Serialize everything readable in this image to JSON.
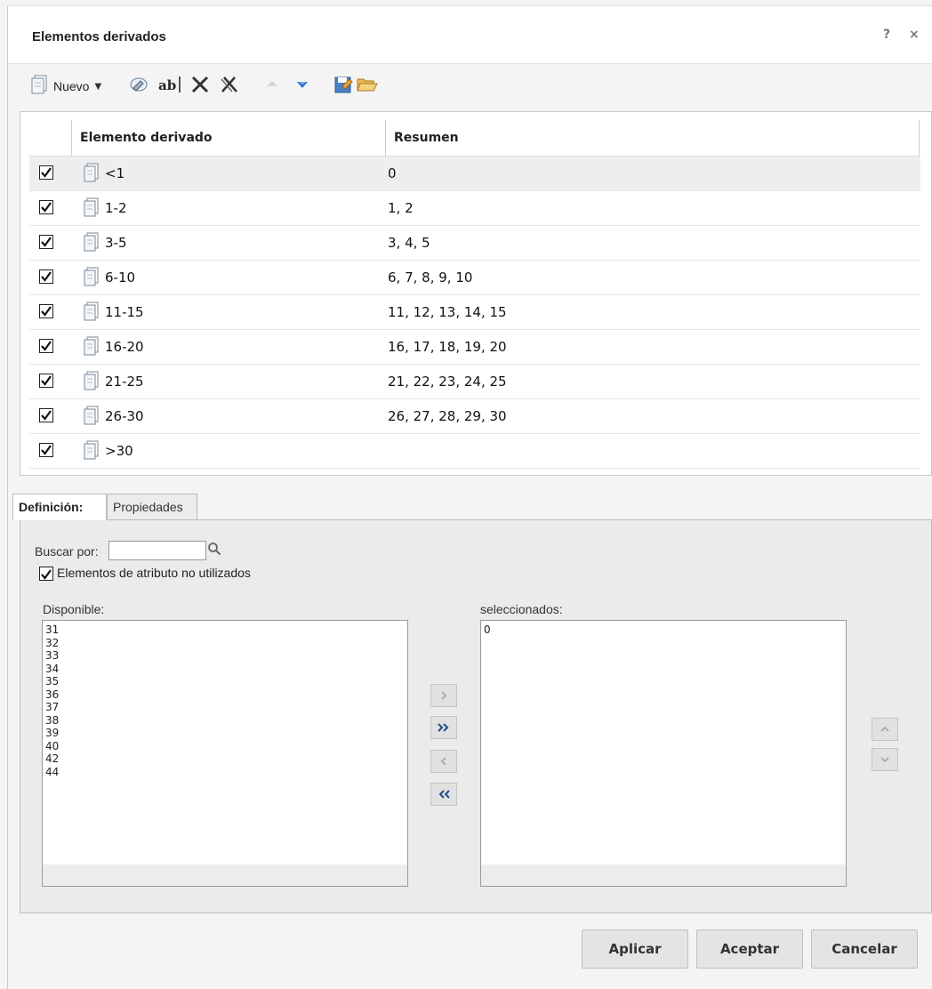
{
  "dialog": {
    "title": "Elementos derivados",
    "help_label": "?",
    "close_label": "×"
  },
  "toolbar": {
    "new_label": "Nuevo"
  },
  "grid": {
    "columns": [
      "Elemento derivado",
      "Resumen"
    ],
    "rows": [
      {
        "name": "<1",
        "summary": "0",
        "checked": true
      },
      {
        "name": "1-2",
        "summary": "1, 2",
        "checked": true
      },
      {
        "name": "3-5",
        "summary": "3, 4, 5",
        "checked": true
      },
      {
        "name": "6-10",
        "summary": "6, 7, 8, 9, 10",
        "checked": true
      },
      {
        "name": "11-15",
        "summary": "11, 12, 13, 14, 15",
        "checked": true
      },
      {
        "name": "16-20",
        "summary": "16, 17, 18, 19, 20",
        "checked": true
      },
      {
        "name": "21-25",
        "summary": "21, 22, 23, 24, 25",
        "checked": true
      },
      {
        "name": "26-30",
        "summary": "26, 27, 28, 29, 30",
        "checked": true
      },
      {
        "name": ">30",
        "summary": "",
        "checked": true
      }
    ]
  },
  "tabs": {
    "definition": "Definición:",
    "properties": "Propiedades"
  },
  "definition": {
    "search_label": "Buscar por:",
    "search_value": "",
    "unused_label": "Elementos de atributo no utilizados",
    "unused_checked": true,
    "available_label": "Disponible:",
    "available_items": [
      "31",
      "32",
      "33",
      "34",
      "35",
      "36",
      "37",
      "38",
      "39",
      "40",
      "42",
      "44"
    ],
    "selected_label": "seleccionados:",
    "selected_items": [
      "0"
    ]
  },
  "buttons": {
    "apply": "Aplicar",
    "accept": "Aceptar",
    "cancel": "Cancelar"
  },
  "colors": {
    "accent_blue": "#2f6fd1",
    "selected_row": "#eeeeee"
  }
}
